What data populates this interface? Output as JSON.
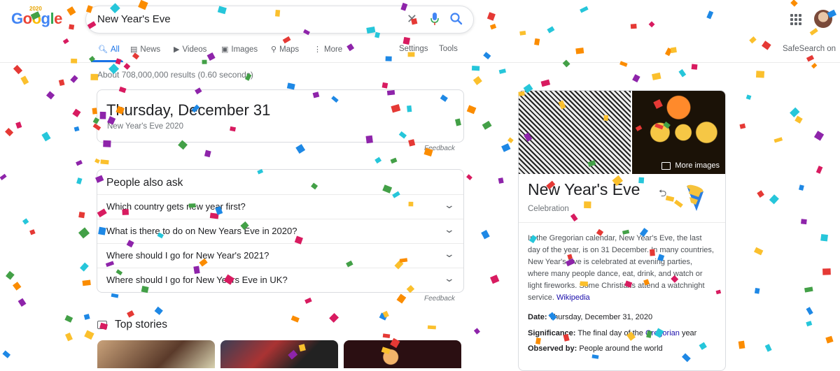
{
  "logo": {
    "text": "Google",
    "badge": "2020"
  },
  "search": {
    "query": "New Year's Eve"
  },
  "tabs": [
    {
      "label": "All",
      "icon": "search-icon"
    },
    {
      "label": "News",
      "icon": "news-icon"
    },
    {
      "label": "Videos",
      "icon": "videos-icon"
    },
    {
      "label": "Images",
      "icon": "images-icon"
    },
    {
      "label": "Maps",
      "icon": "maps-icon"
    },
    {
      "label": "More",
      "icon": "more-dots-icon"
    }
  ],
  "settings_label": "Settings",
  "tools_label": "Tools",
  "safesearch_label": "SafeSearch on",
  "result_stats": "About 708,000,000 results (0.60 seconds)",
  "date_card": {
    "main": "Thursday, December 31",
    "sub": "New Year's Eve 2020",
    "feedback": "Feedback"
  },
  "paa": {
    "title": "People also ask",
    "questions": [
      "Which country gets new year first?",
      "What is there to do on New Years Eve in 2020?",
      "Where should I go for New Year's 2021?",
      "Where should I go for New Years Eve in UK?"
    ],
    "feedback": "Feedback"
  },
  "top_stories": {
    "title": "Top stories"
  },
  "knowledge_panel": {
    "more_images": "More images",
    "title": "New Year's Eve",
    "subtitle": "Celebration",
    "description": "In the Gregorian calendar, New Year's Eve, the last day of the year, is on 31 December. In many countries, New Year's Eve is celebrated at evening parties, where many people dance, eat, drink, and watch or light fireworks. Some Christians attend a watchnight service.",
    "source": "Wikipedia",
    "facts": {
      "date_label": "Date:",
      "date_value": "Thursday, December 31, 2020",
      "significance_label": "Significance:",
      "significance_pre": "The final day of the",
      "significance_link": "Gregorian",
      "significance_post": "year",
      "observed_label": "Observed by:",
      "observed_value": "People around the world"
    }
  },
  "colors": {
    "accent": "#1a73e8",
    "link": "#1a0dab",
    "confetti": [
      "#e53935",
      "#1e88e5",
      "#43a047",
      "#fbc02d",
      "#8e24aa",
      "#26c6da",
      "#fb8c00",
      "#d81b60"
    ]
  }
}
